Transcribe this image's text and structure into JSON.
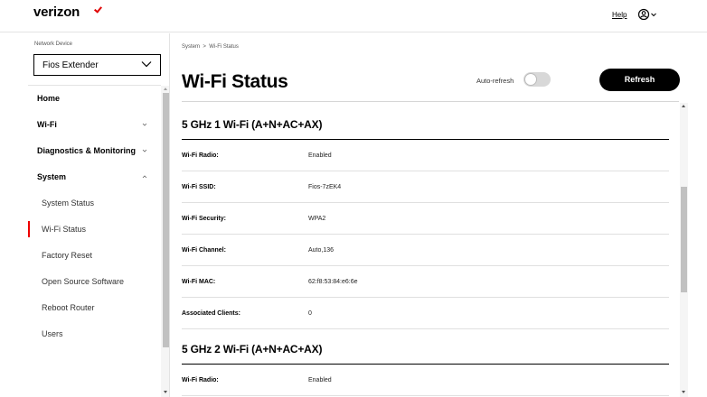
{
  "header": {
    "logo_text": "verizon",
    "help_label": "Help",
    "account_icon": "account-circle-icon",
    "brand_color": "#ee0000"
  },
  "sidebar": {
    "device_label": "Network Device",
    "device_value": "Fios Extender",
    "items": [
      {
        "label": "Home",
        "type": "top"
      },
      {
        "label": "Wi-Fi",
        "type": "top",
        "caret": "down"
      },
      {
        "label": "Diagnostics & Monitoring",
        "type": "top",
        "caret": "down"
      },
      {
        "label": "System",
        "type": "top",
        "caret": "up"
      },
      {
        "label": "System Status",
        "type": "sub"
      },
      {
        "label": "Wi-Fi Status",
        "type": "sub",
        "active": true
      },
      {
        "label": "Factory Reset",
        "type": "sub"
      },
      {
        "label": "Open Source Software",
        "type": "sub"
      },
      {
        "label": "Reboot Router",
        "type": "sub"
      },
      {
        "label": "Users",
        "type": "sub"
      }
    ]
  },
  "main": {
    "breadcrumb": [
      "System",
      "Wi-Fi Status"
    ],
    "breadcrumb_sep": ">",
    "title": "Wi-Fi Status",
    "auto_refresh_label": "Auto-refresh",
    "auto_refresh_on": false,
    "refresh_label": "Refresh",
    "sections": [
      {
        "title": "5 GHz 1 Wi-Fi (A+N+AC+AX)",
        "rows": [
          {
            "key": "Wi-Fi Radio:",
            "value": "Enabled"
          },
          {
            "key": "Wi-Fi SSID:",
            "value": "Fios-7zEK4"
          },
          {
            "key": "Wi-Fi Security:",
            "value": "WPA2"
          },
          {
            "key": "Wi-Fi Channel:",
            "value": "Auto,136"
          },
          {
            "key": "Wi-Fi MAC:",
            "value": "62:f8:53:84:e6:6e"
          },
          {
            "key": "Associated Clients:",
            "value": "0"
          }
        ]
      },
      {
        "title": "5 GHz 2 Wi-Fi (A+N+AC+AX)",
        "rows": [
          {
            "key": "Wi-Fi Radio:",
            "value": "Enabled"
          }
        ]
      }
    ]
  }
}
